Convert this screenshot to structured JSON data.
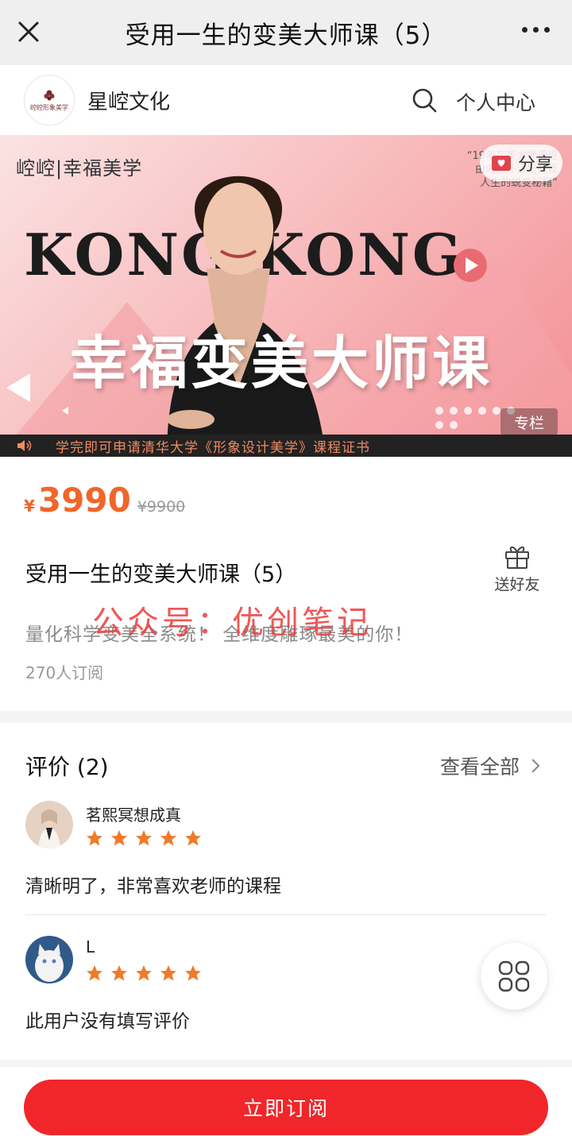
{
  "topbar": {
    "title": "受用一生的变美大师课（5）"
  },
  "shop": {
    "name": "星崆文化",
    "logo_text": "崆崆形象美学",
    "center_label": "个人中心"
  },
  "banner": {
    "brand": "崆崆|幸福美学",
    "quote_lines": [
      "“19年变美大师课程",
      "由内而外活出自我",
      "人生的蜕变秘籍”"
    ],
    "headline_en": "KONG KONG",
    "headline_cn": "幸福变美大师课",
    "share_label": "分享",
    "column_tag": "专栏",
    "notice": "学完即可申请清华大学《形象设计美学》课程证书"
  },
  "info": {
    "currency": "¥",
    "price": "3990",
    "original_price": "¥9900",
    "title": "受用一生的变美大师课（5）",
    "gift_label": "送好友",
    "description": "量化科学变美全系统！ 全维度雕琢最美的你！",
    "watermark": "公众号：优创笔记",
    "subscribers": "270人订阅"
  },
  "reviews": {
    "heading": "评价 (2)",
    "view_all": "查看全部",
    "items": [
      {
        "user": "茗熙冥想成真",
        "rating": 5,
        "text": "清晰明了，非常喜欢老师的课程"
      },
      {
        "user": "L",
        "rating": 5,
        "text": "此用户没有填写评价"
      }
    ]
  },
  "bottom": {
    "subscribe_label": "立即订阅"
  },
  "colors": {
    "accent": "#f0262a",
    "price": "#f0662a",
    "star": "#f07a2a"
  },
  "icons": [
    "close-icon",
    "more-icon",
    "search-icon",
    "share-icon",
    "speaker-icon",
    "gift-icon",
    "chevron-right-icon",
    "star-icon",
    "grid-menu-icon",
    "play-icon"
  ]
}
